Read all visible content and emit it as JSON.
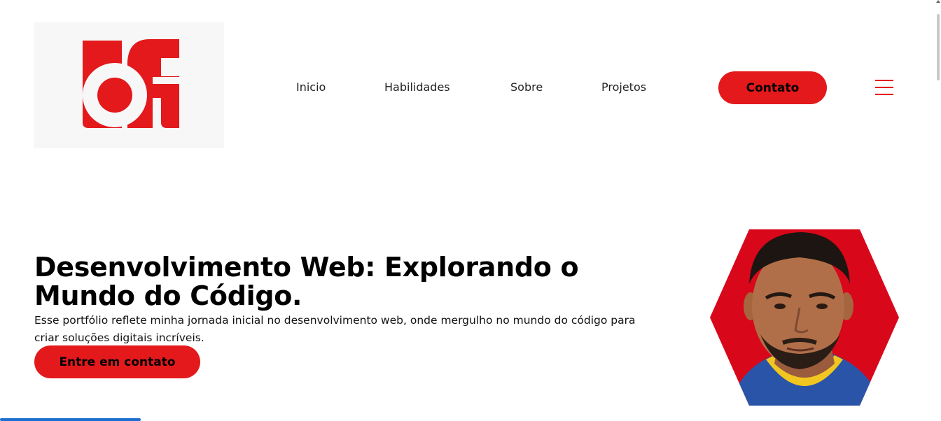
{
  "header": {
    "logo": {
      "alt": "df",
      "icon": "df-logo",
      "background": "#f7f7f7",
      "color": "#e3191b"
    },
    "nav": [
      {
        "label": "Inicio"
      },
      {
        "label": "Habilidades"
      },
      {
        "label": "Sobre"
      },
      {
        "label": "Projetos"
      }
    ],
    "contact_button": "Contato",
    "menu_icon": "hamburger-menu-icon"
  },
  "hero": {
    "title": "Desenvolvimento Web: Explorando o Mundo do Código.",
    "description": "Esse portfólio reflete minha jornada inicial no desenvolvimento web, onde mergulho no mundo do código para criar soluções digitais incríveis.",
    "cta_button": "Entre em contato",
    "photo": {
      "shape": "hexagon",
      "background": "#d9071a"
    }
  },
  "colors": {
    "accent": "#e3191b",
    "text": "#111111",
    "background": "#ffffff"
  }
}
